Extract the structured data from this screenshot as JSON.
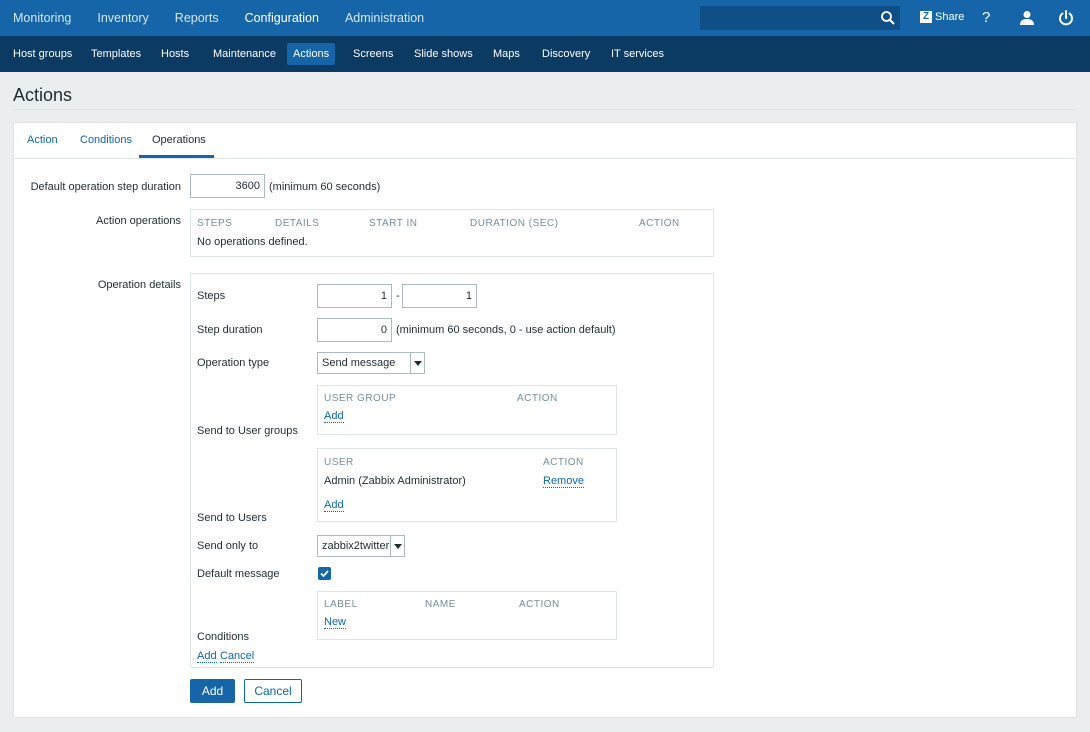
{
  "topnav": {
    "items": [
      "Monitoring",
      "Inventory",
      "Reports",
      "Configuration",
      "Administration"
    ],
    "active": "Configuration",
    "share_label": "Share",
    "help_label": "?",
    "search_value": ""
  },
  "subnav": {
    "items": [
      "Host groups",
      "Templates",
      "Hosts",
      "Maintenance",
      "Actions",
      "Screens",
      "Slide shows",
      "Maps",
      "Discovery",
      "IT services"
    ],
    "active": "Actions"
  },
  "page": {
    "title": "Actions"
  },
  "tabs": [
    "Action",
    "Conditions",
    "Operations"
  ],
  "active_tab": "Operations",
  "form": {
    "step_duration_label": "Default operation step duration",
    "step_duration_value": "3600",
    "step_duration_hint": "(minimum 60 seconds)",
    "action_operations_label": "Action operations",
    "ops_headers": [
      "STEPS",
      "DETAILS",
      "START IN",
      "DURATION (SEC)",
      "ACTION"
    ],
    "ops_empty": "No operations defined.",
    "operation_details_label": "Operation details",
    "steps_label": "Steps",
    "steps_from": "1",
    "steps_dash": "-",
    "steps_to": "1",
    "op_step_duration_label": "Step duration",
    "op_step_duration_value": "0",
    "op_step_duration_hint": "(minimum 60 seconds, 0 - use action default)",
    "operation_type_label": "Operation type",
    "operation_type_value": "Send message",
    "user_groups_label": "Send to User groups",
    "user_groups_headers": [
      "USER GROUP",
      "ACTION"
    ],
    "user_groups_add": "Add",
    "users_label": "Send to Users",
    "users_headers": [
      "USER",
      "ACTION"
    ],
    "users": [
      {
        "name": "Admin (Zabbix Administrator)",
        "action": "Remove"
      }
    ],
    "users_add": "Add",
    "send_only_to_label": "Send only to",
    "send_only_to_value": "zabbix2twitter",
    "default_message_label": "Default message",
    "default_message_checked": true,
    "conditions_label": "Conditions",
    "conditions_headers": [
      "LABEL",
      "NAME",
      "ACTION"
    ],
    "conditions_new": "New",
    "details_add": "Add",
    "details_cancel": "Cancel",
    "add_button": "Add",
    "cancel_button": "Cancel"
  }
}
